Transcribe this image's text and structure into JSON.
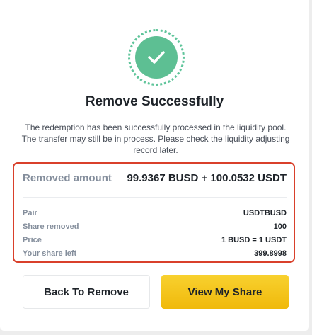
{
  "dialog": {
    "title": "Remove Successfully",
    "message": "The redemption has been successfully processed in the liquidity pool. The transfer may still be in process. Please check the liquidity adjusting record later.",
    "icon": "success-check-icon"
  },
  "summary": {
    "removed_label": "Removed amount",
    "removed_value": "99.9367 BUSD + 100.0532 USDT",
    "details": [
      {
        "label": "Pair",
        "value": "USDTBUSD"
      },
      {
        "label": "Share removed",
        "value": "100"
      },
      {
        "label": "Price",
        "value": "1 BUSD = 1 USDT"
      },
      {
        "label": "Your share left",
        "value": "399.8998"
      }
    ]
  },
  "buttons": {
    "back_label": "Back To Remove",
    "view_label": "View My Share"
  },
  "colors": {
    "success": "#5dbf93",
    "highlight_border": "#d9402b",
    "primary_button": "#f0b90b"
  }
}
